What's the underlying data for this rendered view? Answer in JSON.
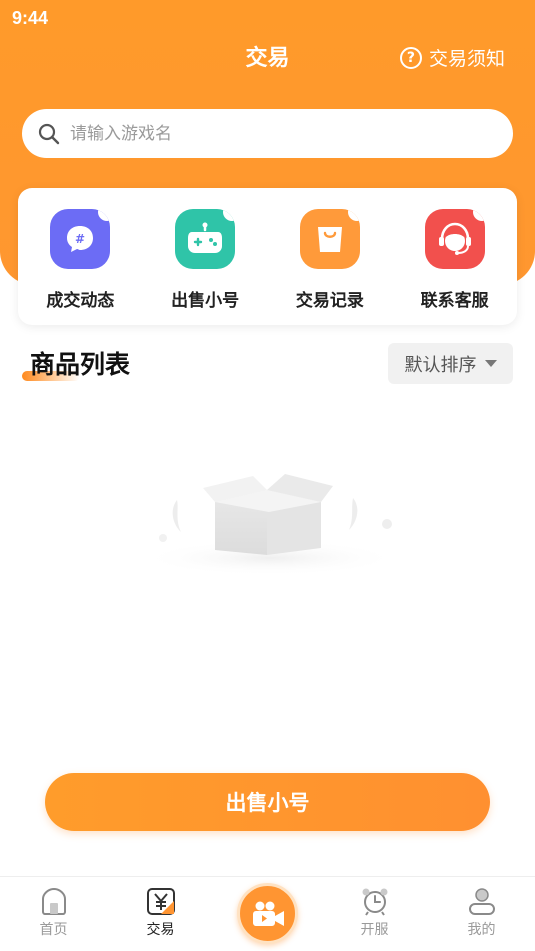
{
  "status_bar": {
    "time": "9:44"
  },
  "header": {
    "title": "交易",
    "notice_label": "交易须知"
  },
  "search": {
    "placeholder": "请输入游戏名"
  },
  "quick_actions": [
    {
      "label": "成交动态",
      "icon": "hashtag-chat-icon",
      "color": "#6c6cf5"
    },
    {
      "label": "出售小号",
      "icon": "gamepad-icon",
      "color": "#2fc4a8"
    },
    {
      "label": "交易记录",
      "icon": "shopping-bag-icon",
      "color": "#ff9a3a"
    },
    {
      "label": "联系客服",
      "icon": "customer-service-icon",
      "color": "#f2504d"
    }
  ],
  "section": {
    "title": "商品列表",
    "sort_label": "默认排序"
  },
  "sell_button": {
    "label": "出售小号"
  },
  "tabbar": {
    "tabs": [
      {
        "label": "首页",
        "icon": "home-icon"
      },
      {
        "label": "交易",
        "icon": "yen-trade-icon",
        "active": true
      },
      {
        "label": "",
        "icon": "video-camera-icon"
      },
      {
        "label": "开服",
        "icon": "alarm-clock-icon"
      },
      {
        "label": "我的",
        "icon": "user-icon"
      }
    ]
  },
  "colors": {
    "brand_orange": "#ff9a2a",
    "inactive_tab": "#9a9a9a"
  }
}
